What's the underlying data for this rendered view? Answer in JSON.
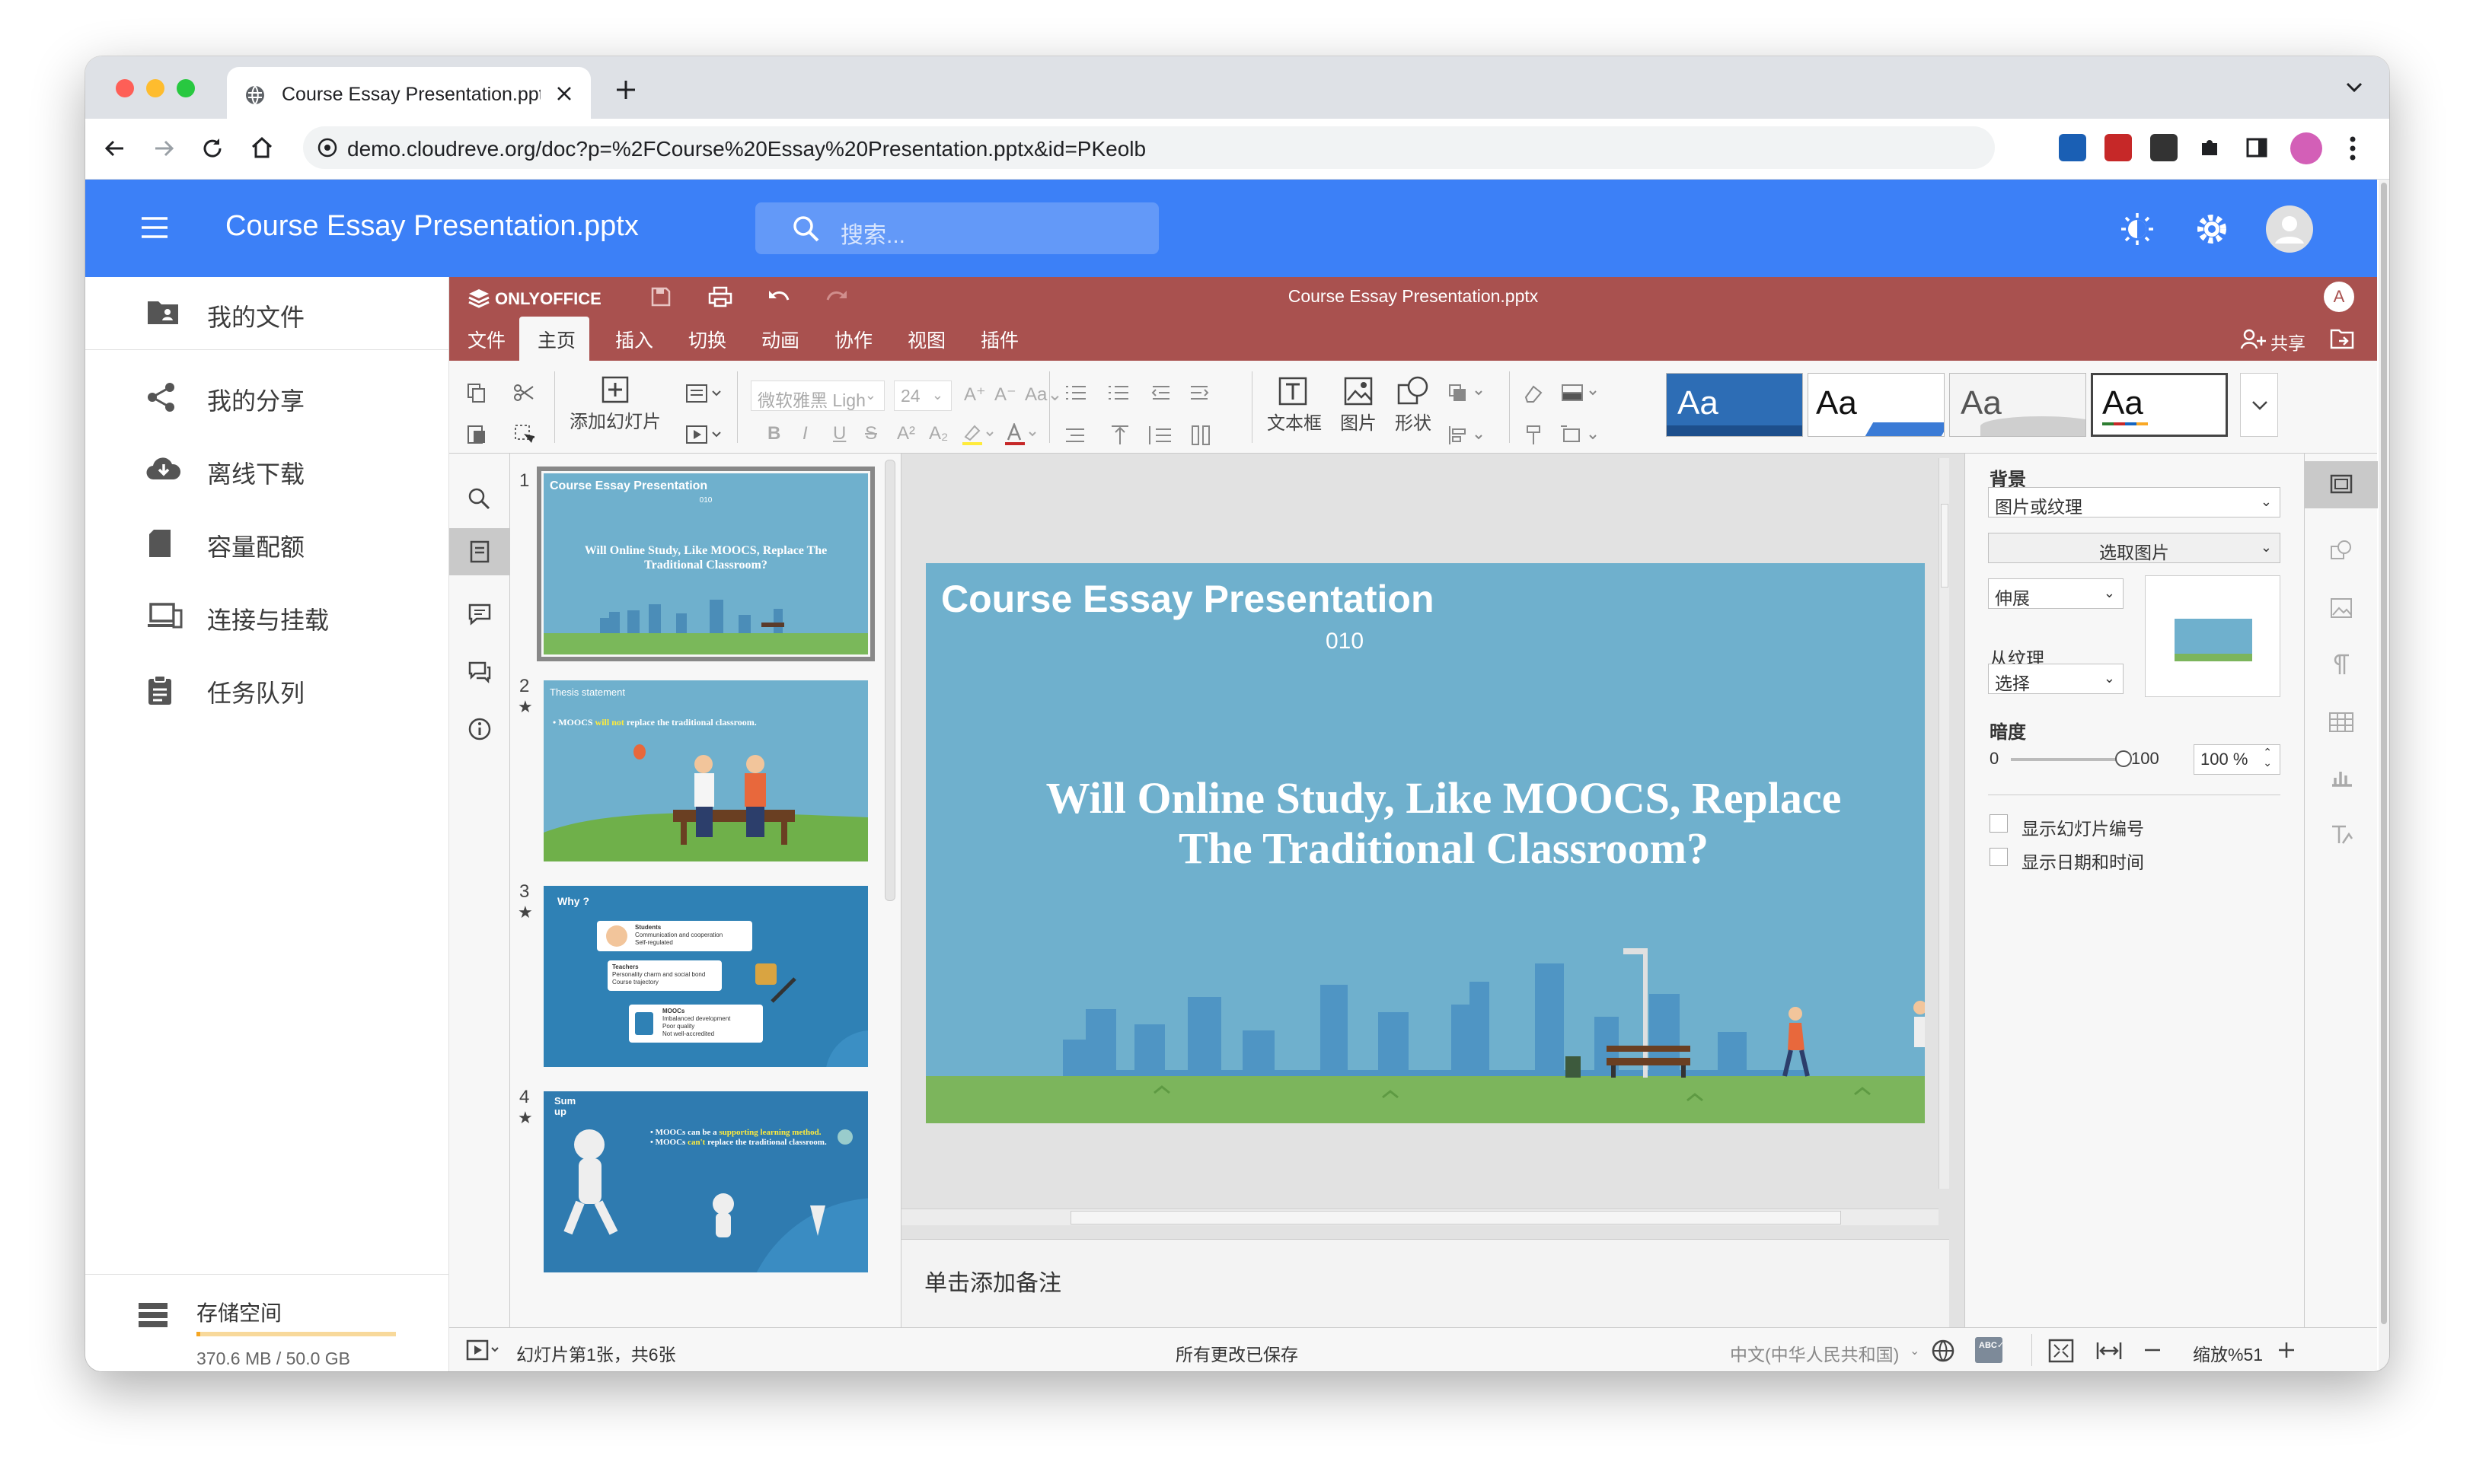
{
  "browser": {
    "tab_title": "Course Essay Presentation.ppt",
    "url": "demo.cloudreve.org/doc?p=%2FCourse%20Essay%20Presentation.pptx&id=PKeolb"
  },
  "app": {
    "title": "Course Essay Presentation.pptx",
    "search_placeholder": "搜索...",
    "brand_color": "#3c80f7"
  },
  "sidebar": {
    "items": [
      {
        "label": "我的文件",
        "icon": "folder-user-icon"
      },
      {
        "label": "我的分享",
        "icon": "share-icon"
      },
      {
        "label": "离线下载",
        "icon": "cloud-download-icon"
      },
      {
        "label": "容量配额",
        "icon": "sd-card-icon"
      },
      {
        "label": "连接与挂载",
        "icon": "devices-icon"
      },
      {
        "label": "任务队列",
        "icon": "clipboard-icon"
      }
    ],
    "storage_label": "存储空间",
    "storage_value": "370.6 MB / 50.0 GB",
    "storage_fraction": 0.0074
  },
  "onlyoffice": {
    "brand": "ONLYOFFICE",
    "doc_title": "Course Essay Presentation.pptx",
    "avatar_letter": "A",
    "header_color": "#a9514f",
    "menu": [
      "文件",
      "主页",
      "插入",
      "切换",
      "动画",
      "协作",
      "视图",
      "插件"
    ],
    "active_menu": "主页",
    "share_label": "共享",
    "toolbar": {
      "add_slide": "添加幻灯片",
      "font_name": "微软雅黑 Ligh",
      "font_size": "24",
      "text_box": "文本框",
      "image": "图片",
      "shape": "形状",
      "theme_sample": "Aa"
    }
  },
  "slides": [
    {
      "num": "1",
      "title": "Course Essay Presentation",
      "sub": "010",
      "body": "Will Online Study,  Like MOOCS,  Replace The Traditional Classroom?"
    },
    {
      "num": "2",
      "title": "Thesis statement",
      "bullet_prefix": "MOOCS ",
      "bullet_highlight": "will not",
      "bullet_suffix": " replace the traditional classroom."
    },
    {
      "num": "3",
      "title": "Why ?",
      "box1_title": "Students",
      "box1_lines": [
        "Communication and cooperation",
        "Self-regulated"
      ],
      "box2_title": "Teachers",
      "box2_lines": [
        "Personality charm and social bond",
        "Course trajectory"
      ],
      "box3_title": "MOOCs",
      "box3_lines": [
        "Imbalanced development",
        "Poor quality",
        "Not well-accredited"
      ]
    },
    {
      "num": "4",
      "title": "Sum up",
      "line1_prefix": "MOOCs can be a ",
      "line1_highlight": "supporting learning method.",
      "line2_prefix": "MOOCs ",
      "line2_highlight": "can't",
      "line2_suffix": " replace the traditional classroom."
    }
  ],
  "editor": {
    "slide_title": "Course Essay Presentation",
    "slide_sub": "010",
    "slide_body_line1": "Will Online Study,  Like MOOCS,  Replace",
    "slide_body_line2": "The Traditional Classroom?",
    "notes_placeholder": "单击添加备注"
  },
  "right_panel": {
    "background_label": "背景",
    "fill_type": "图片或纹理",
    "select_image": "选取图片",
    "stretch": "伸展",
    "from_texture_label": "从纹理",
    "texture_select": "选择",
    "transparency_label": "暗度",
    "slider_min": "0",
    "slider_max": "100",
    "slider_value": "100 %",
    "slider_fraction": 1.0,
    "show_slide_number": "显示幻灯片编号",
    "show_date_time": "显示日期和时间"
  },
  "status": {
    "slide_info": "幻灯片第1张，共6张",
    "saved": "所有更改已保存",
    "language": "中文(中华人民共和国)",
    "zoom": "缩放%51"
  }
}
